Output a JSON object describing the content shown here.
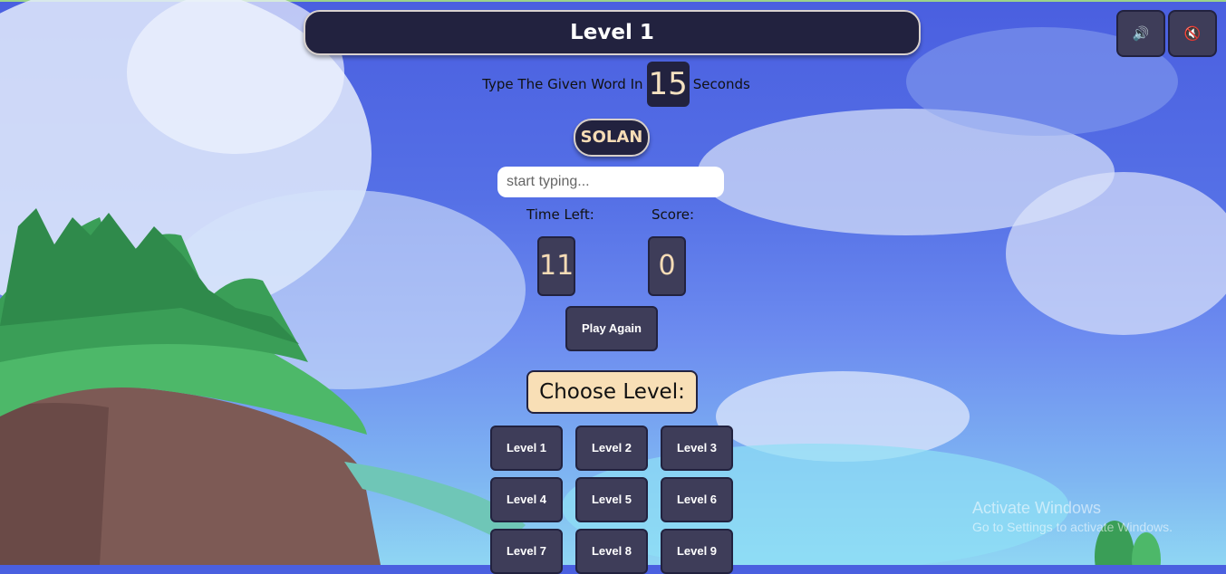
{
  "header": {
    "title": "Level 1"
  },
  "controls": {
    "sound_on_icon": "speaker-icon",
    "mute_icon": "mute-icon"
  },
  "instruction": {
    "prefix": "Type The Given Word In",
    "seconds": "15",
    "suffix": "Seconds"
  },
  "word": "SOLAN",
  "input": {
    "placeholder": "start typing...",
    "value": ""
  },
  "stats": {
    "time_label": "Time Left:",
    "score_label": "Score:",
    "time_left": "11",
    "score": "0"
  },
  "play_again_label": "Play Again",
  "choose_level_label": "Choose Level:",
  "levels": [
    "Level 1",
    "Level 2",
    "Level 3",
    "Level 4",
    "Level 5",
    "Level 6",
    "Level 7",
    "Level 8",
    "Level 9"
  ],
  "watermark": {
    "line1": "Activate Windows",
    "line2": "Go to Settings to activate Windows."
  },
  "colors": {
    "dark": "#22223f",
    "button": "#3e3d59",
    "accent": "#f6dcb6",
    "sky": "#4a5fe0"
  }
}
